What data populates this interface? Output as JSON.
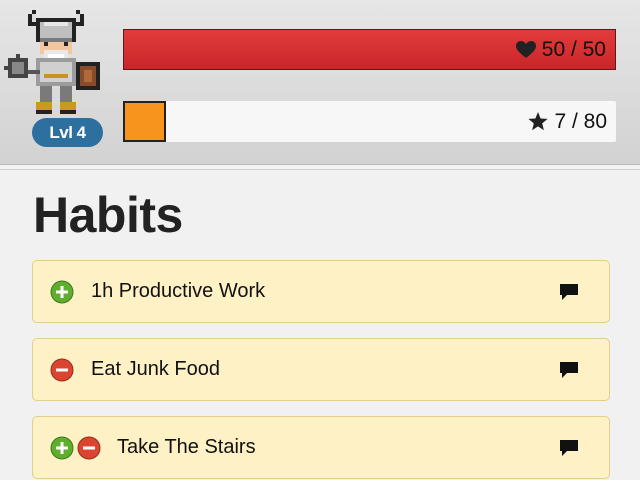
{
  "stats": {
    "level": "Lvl 4",
    "hp_text": "50 / 50",
    "hp_fraction": 1.0,
    "xp_text": "7 / 80",
    "xp_fraction": 0.0875
  },
  "section": {
    "title": "Habits"
  },
  "habits": [
    {
      "label": "1h Productive Work",
      "up": true,
      "down": false
    },
    {
      "label": "Eat Junk Food",
      "up": false,
      "down": true
    },
    {
      "label": "Take The Stairs",
      "up": true,
      "down": true
    }
  ],
  "colors": {
    "hp": "#d12f33",
    "xp": "#f7941d",
    "level_badge": "#2d6f9f",
    "habit_bg": "#fff1c6",
    "plus": "#5fae2e",
    "minus": "#d9452f"
  },
  "icons": {
    "hp": "heart-icon",
    "xp": "star-icon",
    "plus": "plus-circle-icon",
    "minus": "minus-circle-icon",
    "note": "comment-icon"
  }
}
